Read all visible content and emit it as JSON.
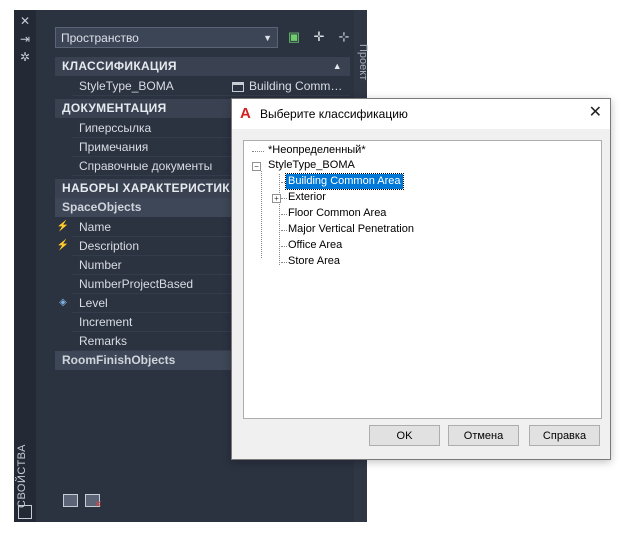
{
  "palette": {
    "vertical_title": "СВОЙСТВА",
    "side_tab": "Проект",
    "dropdown_value": "Пространство",
    "sections": {
      "classification": "КЛАССИФИКАЦИЯ",
      "documentation": "ДОКУМЕНТАЦИЯ",
      "property_sets": "НАБОРЫ ХАРАКТЕРИСТИК"
    },
    "classification_row": {
      "label": "StyleType_BOMA",
      "value": "Building Comm…"
    },
    "documentation_rows": [
      "Гиперссылка",
      "Примечания",
      "Справочные документы"
    ],
    "space_objects_header": "SpaceObjects",
    "space_rows": [
      "Name",
      "Description",
      "Number",
      "NumberProjectBased",
      "Level",
      "Increment",
      "Remarks"
    ],
    "room_finish_header": "RoomFinishObjects"
  },
  "dialog": {
    "title": "Выберите классификацию",
    "tree": {
      "undefined": "*Неопределенный*",
      "root": "StyleType_BOMA",
      "children": [
        "Building Common Area",
        "Exterior",
        "Floor Common Area",
        "Major Vertical Penetration",
        "Office Area",
        "Store Area"
      ]
    },
    "buttons": {
      "ok": "OK",
      "cancel": "Отмена",
      "help": "Справка"
    }
  }
}
